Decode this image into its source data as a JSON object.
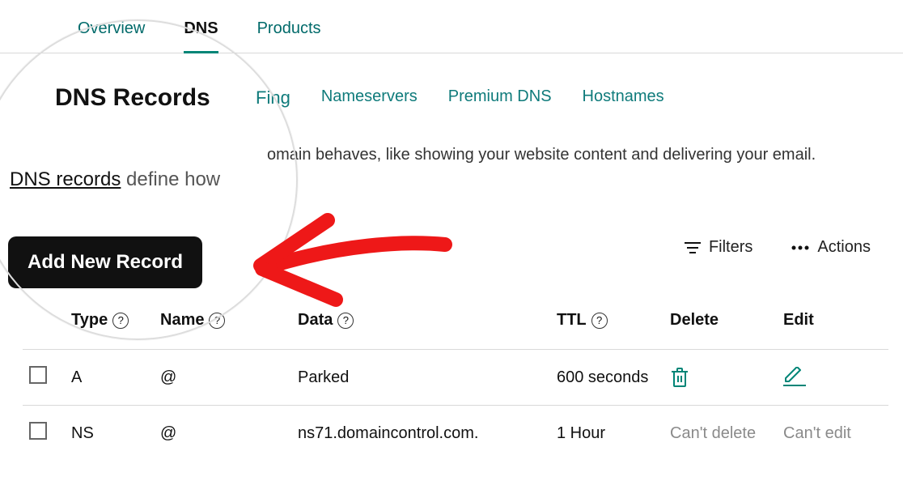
{
  "topTabs": {
    "overview": "Overview",
    "dns": "DNS",
    "products": "Products"
  },
  "sectionTitle": "DNS Records",
  "subTabs": {
    "forwarding_visible": "ing",
    "nameservers": "Nameservers",
    "premium": "Premium DNS",
    "hostnames": "Hostnames"
  },
  "mainDescFragment": "omain behaves, like showing your website content and delivering your email.",
  "recDesc": {
    "link": "DNS records",
    "rest": " define how"
  },
  "addRecord": "Add New Record",
  "controls": {
    "filters": "Filters",
    "actions": "Actions"
  },
  "headers": {
    "type": "Type",
    "name": "Name",
    "data": "Data",
    "ttl": "TTL",
    "delete": "Delete",
    "edit": "Edit"
  },
  "rows": [
    {
      "type": "A",
      "name": "@",
      "data": "Parked",
      "ttl": "600 seconds",
      "canDelete": true,
      "canEdit": true
    },
    {
      "type": "NS",
      "name": "@",
      "data": "ns71.domaincontrol.com.",
      "ttl": "1 Hour",
      "canDelete": false,
      "canEdit": false
    }
  ],
  "disabledText": {
    "delete": "Can't delete",
    "edit": "Can't edit"
  },
  "helpGlyph": "?"
}
